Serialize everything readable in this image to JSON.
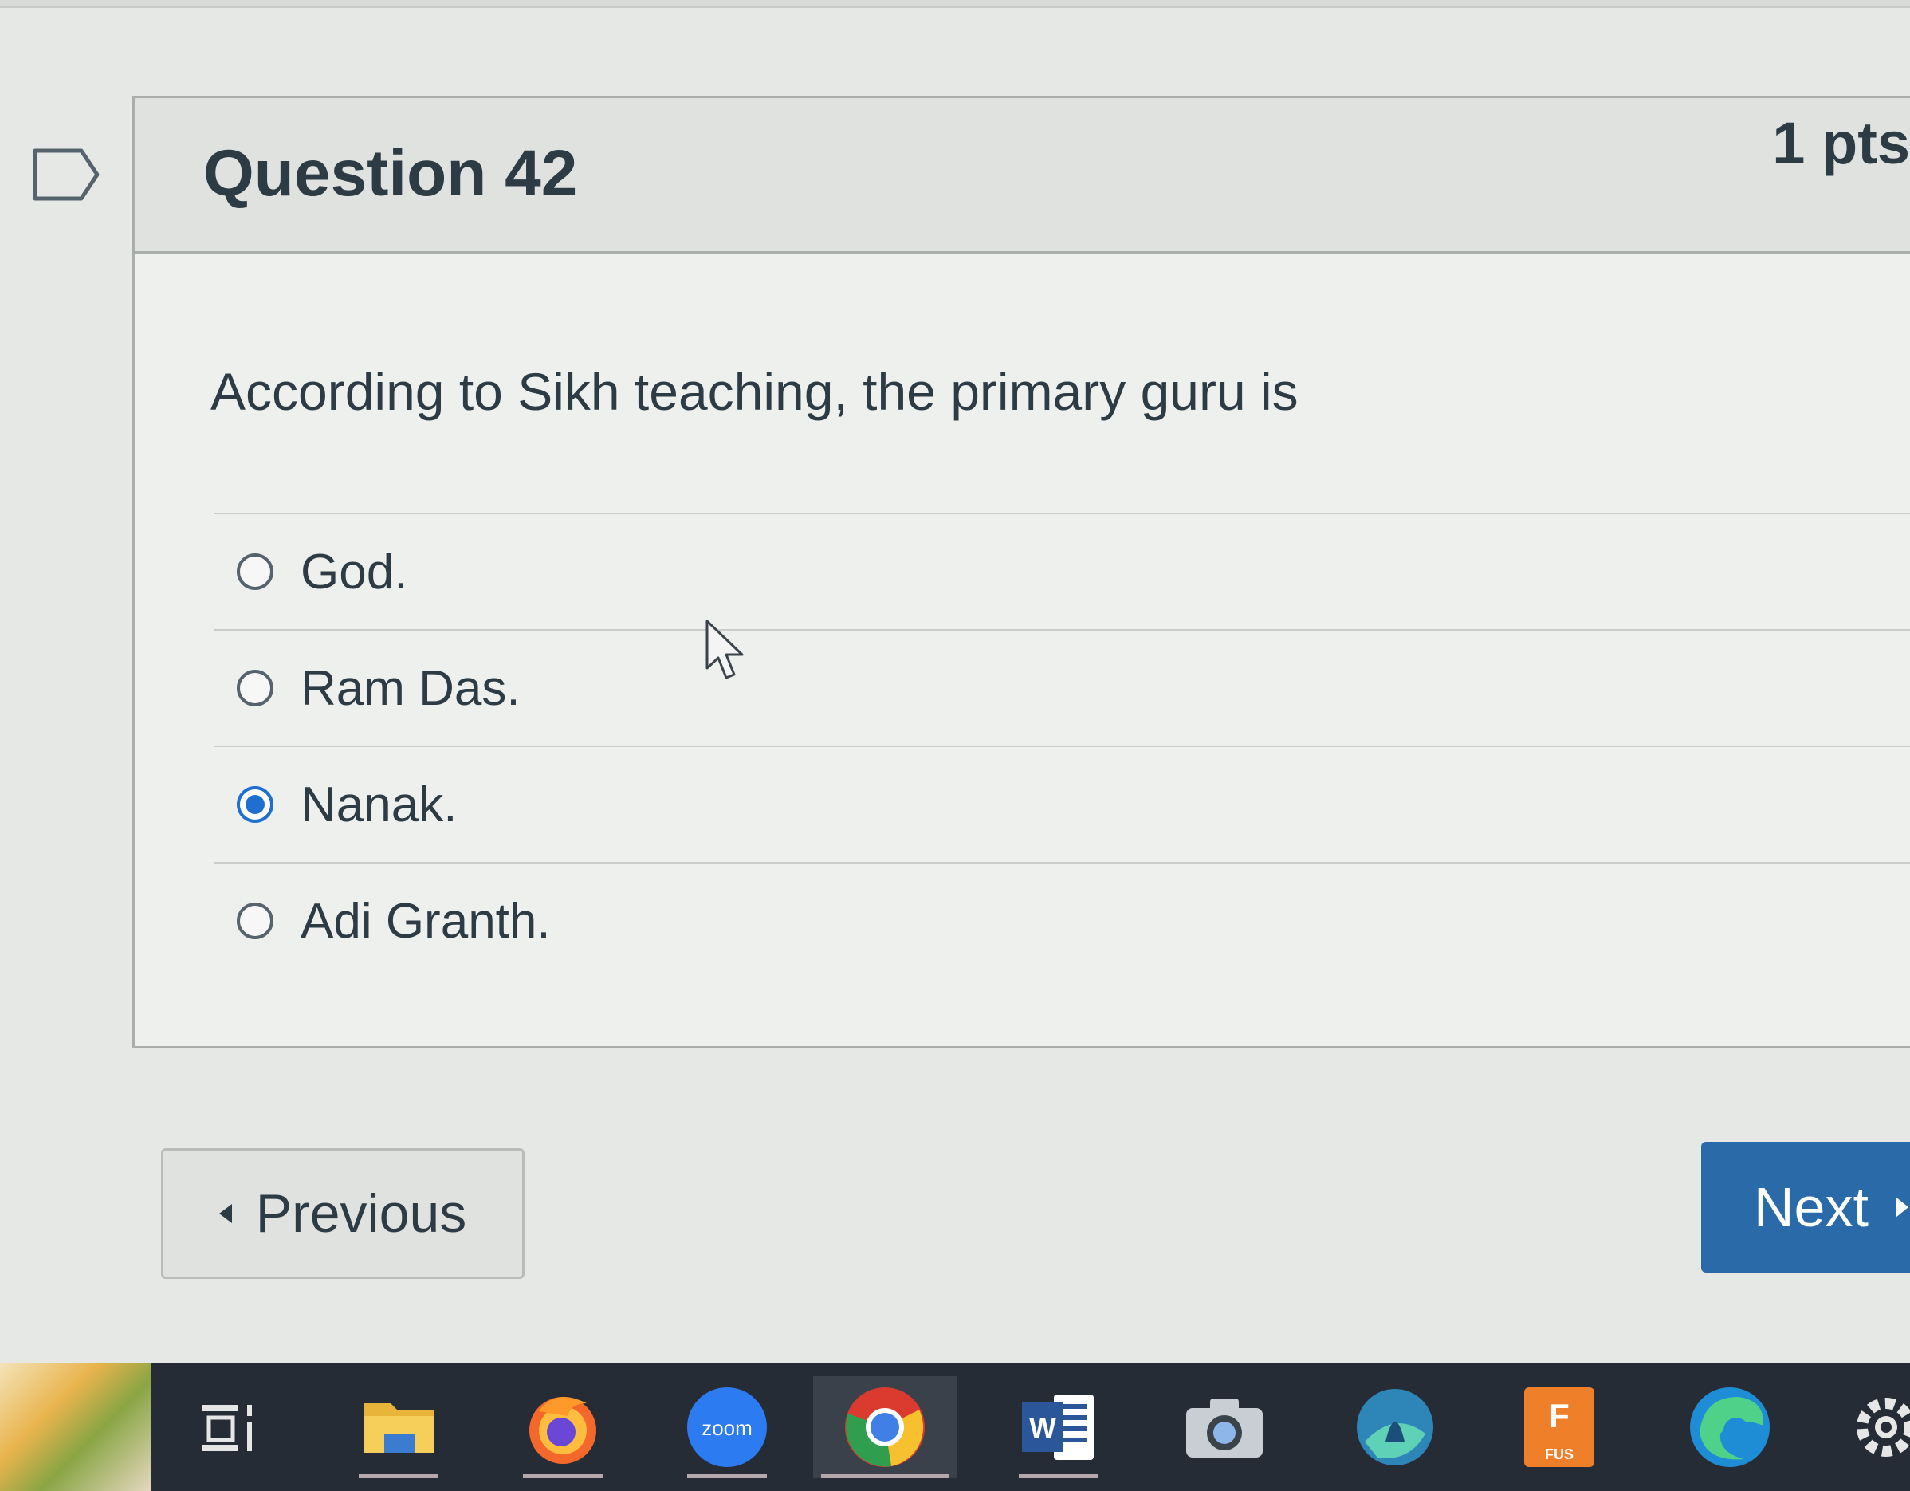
{
  "question": {
    "title": "Question 42",
    "points": "1 pts",
    "text": "According to Sikh teaching, the primary guru is",
    "answers": [
      {
        "label": "God.",
        "selected": false
      },
      {
        "label": "Ram Das.",
        "selected": false
      },
      {
        "label": "Nanak.",
        "selected": true
      },
      {
        "label": "Adi Granth.",
        "selected": false
      }
    ]
  },
  "navigation": {
    "previous_label": "Previous",
    "next_label": "Next"
  },
  "taskbar": {
    "zoom_label": "zoom",
    "word_label": "W",
    "fus_label": "F",
    "fus_sublabel": "FUS",
    "icons": [
      "task-view-icon",
      "file-explorer-icon",
      "firefox-icon",
      "zoom-icon",
      "chrome-icon",
      "word-icon",
      "camera-icon",
      "app-icon",
      "fus-icon",
      "edge-icon",
      "settings-icon"
    ]
  },
  "colors": {
    "accent": "#2b6aa8",
    "radio_selected": "#1f6fd1",
    "text": "#2d3b45",
    "taskbar": "#262c35"
  }
}
